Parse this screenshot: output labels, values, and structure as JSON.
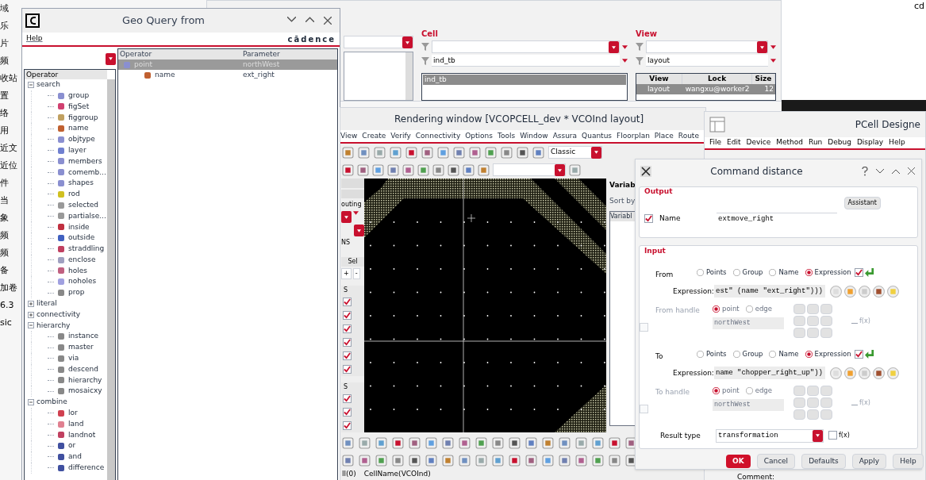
{
  "desktop_sidebar": [
    "域",
    "乐",
    "片",
    "频",
    "收站",
    "置",
    "络",
    "用",
    "近文",
    "近位",
    "件",
    "当",
    "象",
    "频",
    "频",
    "备",
    "加卷",
    "6.3",
    "sic"
  ],
  "corner_text": "cd",
  "library_manager": {
    "cell": {
      "title": "Cell",
      "value": "ind_tb",
      "items": [
        {
          "label": "ind_tb",
          "selected": true
        }
      ]
    },
    "view": {
      "title": "View",
      "value": "layout",
      "columns": [
        "View",
        "Lock",
        "Size"
      ],
      "rows": [
        {
          "cells": [
            "layout",
            "wangxu@worker2",
            "12"
          ],
          "selected": true
        }
      ]
    }
  },
  "geo_query": {
    "title": "Geo Query from",
    "menu": [
      "Help"
    ],
    "brand": "cādence",
    "tree_header": "Operator",
    "tree": [
      {
        "label": "search",
        "expanded": true,
        "children": [
          {
            "label": "group"
          },
          {
            "label": "figSet"
          },
          {
            "label": "figgroup"
          },
          {
            "label": "name"
          },
          {
            "label": "objtype"
          },
          {
            "label": "layer"
          },
          {
            "label": "members"
          },
          {
            "label": "comemb..."
          },
          {
            "label": "shapes"
          },
          {
            "label": "rod"
          },
          {
            "label": "selected"
          },
          {
            "label": "partialse..."
          },
          {
            "label": "inside"
          },
          {
            "label": "outside"
          },
          {
            "label": "straddling"
          },
          {
            "label": "enclose"
          },
          {
            "label": "holes"
          },
          {
            "label": "noholes"
          },
          {
            "label": "prop"
          }
        ]
      },
      {
        "label": "literal",
        "expanded": false
      },
      {
        "label": "connectivity",
        "expanded": false
      },
      {
        "label": "hierarchy",
        "expanded": true,
        "children": [
          {
            "label": "instance"
          },
          {
            "label": "master"
          },
          {
            "label": "via"
          },
          {
            "label": "descend"
          },
          {
            "label": "hierarchy"
          },
          {
            "label": "mosaicxy"
          }
        ]
      },
      {
        "label": "combine",
        "expanded": true,
        "children": [
          {
            "label": "lor"
          },
          {
            "label": "land"
          },
          {
            "label": "landnot"
          },
          {
            "label": "or"
          },
          {
            "label": "and"
          },
          {
            "label": "difference"
          }
        ]
      }
    ],
    "table": {
      "columns": [
        "Operator",
        "Parameter"
      ],
      "rows": [
        {
          "operator": "point",
          "parameter": "northWest",
          "selected": true
        },
        {
          "operator": "name",
          "parameter": "ext_right",
          "selected": false
        }
      ]
    }
  },
  "rendering": {
    "title": "Rendering window [VCOPCELL_dev * VCOInd layout]",
    "menu": [
      "View",
      "Create",
      "Verify",
      "Connectivity",
      "Options",
      "Tools",
      "Window",
      "Assura",
      "Quantus",
      "Floorplan",
      "Place",
      "Route"
    ],
    "style_combo": "Classic",
    "dock": {
      "routing": "outing",
      "ns": "NS",
      "sel": "Sel",
      "plus": "+",
      "minus": "-",
      "lists": [
        {
          "header": "S",
          "checks": [
            {
              "checked": true
            },
            {
              "checked": true
            },
            {
              "checked": true
            },
            {
              "checked": true
            },
            {
              "checked": true
            },
            {
              "checked": true
            }
          ]
        },
        {
          "header": "S",
          "checks": [
            {
              "checked": true
            },
            {
              "checked": true
            },
            {
              "checked": true
            }
          ]
        }
      ]
    },
    "panel": {
      "title": "Variab",
      "sort": "Sort by",
      "column": "Variabl"
    },
    "status": [
      "ll(0)",
      "CellName(VCOInd)"
    ]
  },
  "pcell": {
    "title": "PCell Designe",
    "menu": [
      "File",
      "Edit",
      "Device",
      "Method",
      "Run",
      "Debug",
      "Display",
      "Help"
    ],
    "comment": "Comment:"
  },
  "dialog": {
    "title": "Command distance",
    "output": {
      "title": "Output",
      "assistant": "Assistant",
      "checked": true,
      "label": "Name",
      "value": "extmove_right"
    },
    "input": {
      "title": "Input",
      "endpoints": [
        {
          "label": "From",
          "options": [
            {
              "label": "Points",
              "selected": false
            },
            {
              "label": "Group",
              "selected": false
            },
            {
              "label": "Name",
              "selected": false
            },
            {
              "label": "Expression",
              "selected": true
            }
          ],
          "checked": true,
          "expression_label": "Expression:",
          "expression": "est\" (name \"ext_right\")))",
          "handle": {
            "label": "From handle",
            "enabled": false,
            "checked": false,
            "options": [
              {
                "label": "point",
                "selected": true
              },
              {
                "label": "edge",
                "selected": false
              }
            ],
            "value": "northWest",
            "fx": "f(x)"
          }
        },
        {
          "label": "To",
          "options": [
            {
              "label": "Points",
              "selected": false
            },
            {
              "label": "Group",
              "selected": false
            },
            {
              "label": "Name",
              "selected": false
            },
            {
              "label": "Expression",
              "selected": true
            }
          ],
          "checked": true,
          "expression_label": "Expression:",
          "expression": "name \"chopper_right_up\"))",
          "handle": {
            "label": "To handle",
            "enabled": false,
            "checked": false,
            "options": [
              {
                "label": "point",
                "selected": true
              },
              {
                "label": "edge",
                "selected": false
              }
            ],
            "value": "northWest",
            "fx": "f(x)"
          }
        }
      ],
      "result": {
        "label": "Result type",
        "value": "transformation",
        "fx": "f(x)",
        "fx_checked": false
      }
    },
    "buttons": [
      {
        "label": "OK",
        "primary": true
      },
      {
        "label": "Cancel",
        "primary": false
      },
      {
        "label": "Defaults",
        "primary": false
      },
      {
        "label": "Apply",
        "primary": false
      },
      {
        "label": "Help",
        "primary": false
      }
    ]
  }
}
